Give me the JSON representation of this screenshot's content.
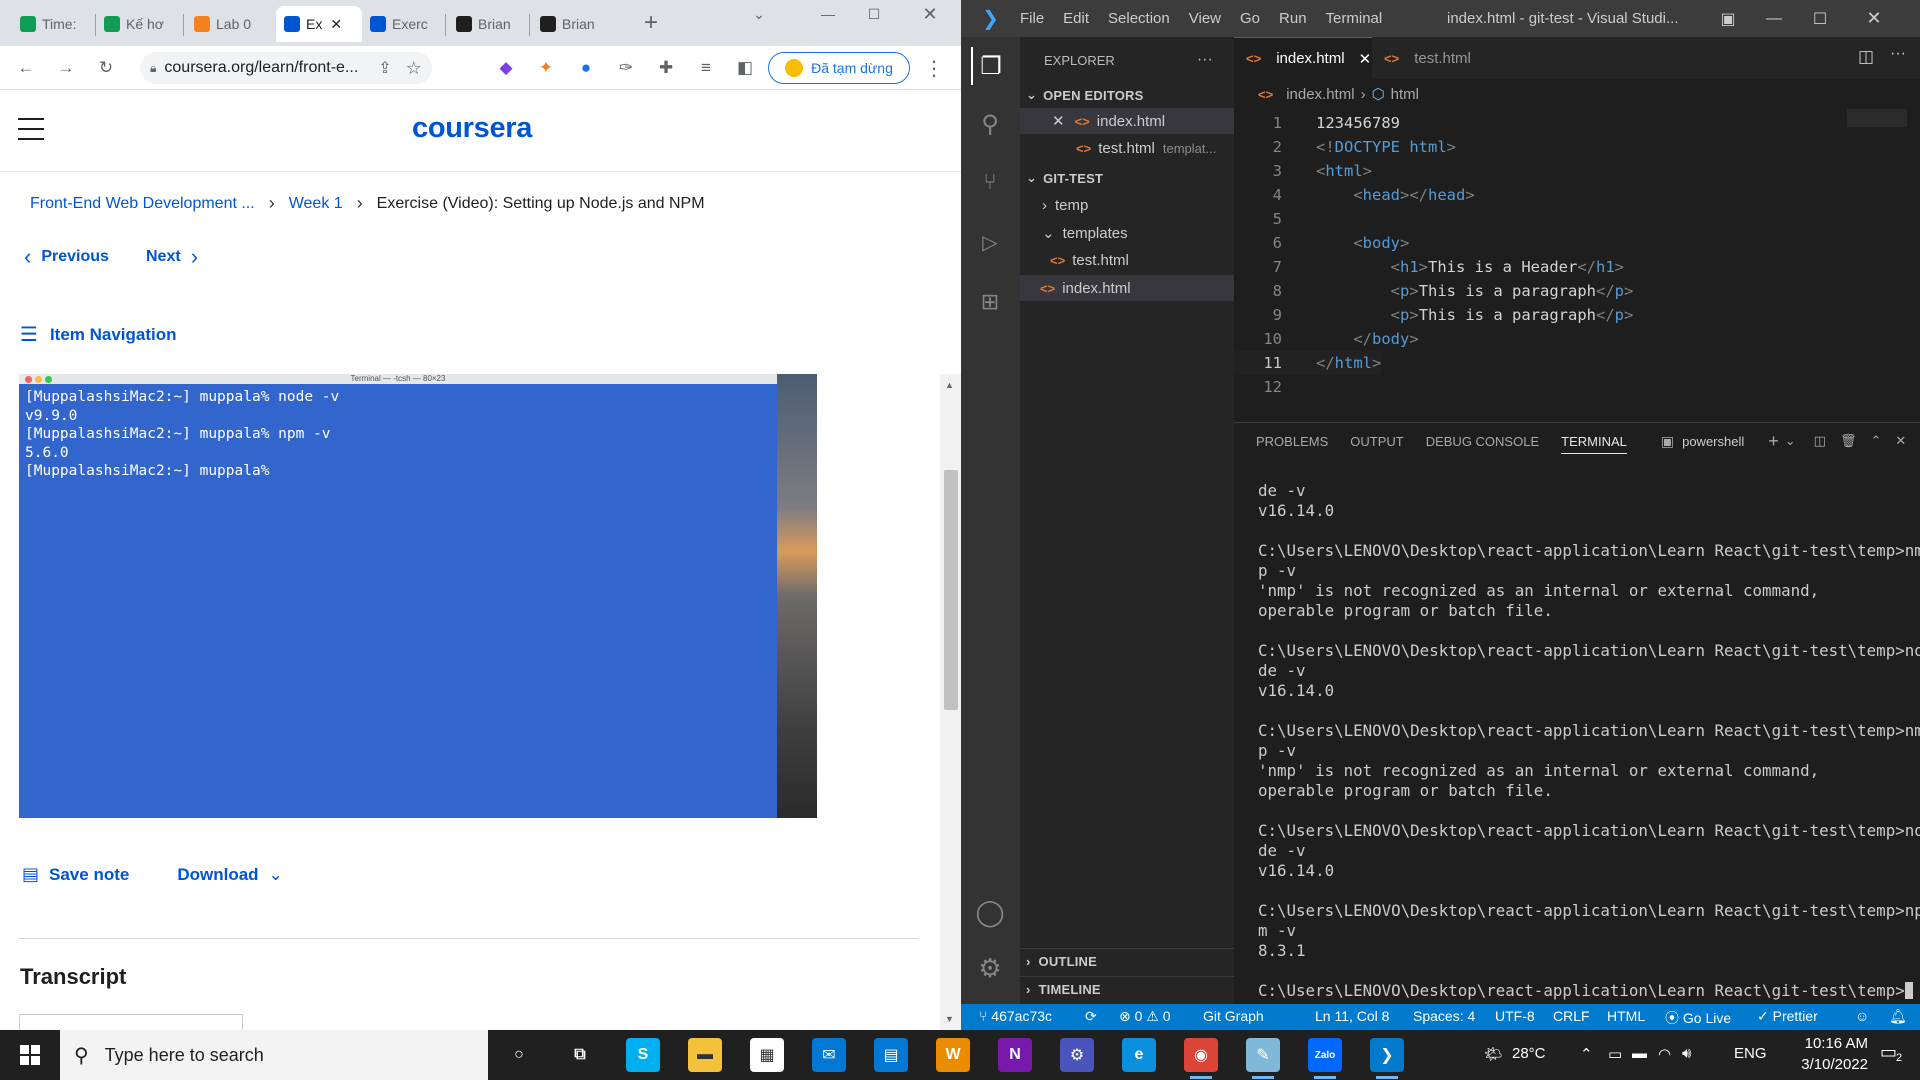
{
  "browser": {
    "tabs": [
      {
        "label": "Time:",
        "icon": "sheets-icon",
        "color": "#0f9d58"
      },
      {
        "label": "Kế hơ",
        "icon": "sheets-icon",
        "color": "#0f9d58"
      },
      {
        "label": "Lab 0",
        "icon": "figure-icon",
        "color": "#f5821f"
      },
      {
        "label": "Ex",
        "icon": "coursera-icon",
        "color": "#0056d2"
      },
      {
        "label": "Exerc",
        "icon": "coursera-icon",
        "color": "#0056d2"
      },
      {
        "label": "Brian",
        "icon": "github-icon",
        "color": "#1f1f1f"
      },
      {
        "label": "Brian",
        "icon": "github-icon",
        "color": "#1f1f1f"
      }
    ],
    "url": "coursera.org/learn/front-e...",
    "paused_label": "Đã tạm dừng"
  },
  "coursera": {
    "logo": "coursera",
    "breadcrumb": {
      "course": "Front-End Web Development ...",
      "week": "Week 1",
      "item": "Exercise (Video): Setting up Node.js and NPM"
    },
    "prev_label": "Previous",
    "next_label": "Next",
    "item_nav_label": "Item Navigation",
    "video": {
      "window_title": "Terminal — -tcsh — 80×23",
      "lines": [
        "[MuppalashsiMac2:~] muppala% node -v",
        "v9.9.0",
        "[MuppalashsiMac2:~] muppala% npm -v",
        "5.6.0",
        "[MuppalashsiMac2:~] muppala% "
      ]
    },
    "save_note_label": "Save note",
    "download_label": "Download",
    "transcript_heading": "Transcript"
  },
  "vscode": {
    "menu": [
      "File",
      "Edit",
      "Selection",
      "View",
      "Go",
      "Run",
      "Terminal"
    ],
    "title": "index.html - git-test - Visual Studi...",
    "explorer_label": "EXPLORER",
    "open_editors_label": "OPEN EDITORS",
    "open_editors": [
      {
        "name": "index.html",
        "detail": ""
      },
      {
        "name": "test.html",
        "detail": "templat..."
      }
    ],
    "workspace_label": "GIT-TEST",
    "tree": [
      {
        "name": "temp",
        "kind": "folder"
      },
      {
        "name": "templates",
        "kind": "folder"
      },
      {
        "name": "test.html",
        "kind": "file"
      },
      {
        "name": "index.html",
        "kind": "file"
      }
    ],
    "outline_label": "OUTLINE",
    "timeline_label": "TIMELINE",
    "editor_tabs": [
      "index.html",
      "test.html"
    ],
    "breadcrumb_file": "index.html",
    "breadcrumb_symbol": "html",
    "code": [
      {
        "n": "1",
        "indent": "",
        "parts": [
          {
            "c": "txt",
            "t": "123456789"
          }
        ]
      },
      {
        "n": "2",
        "indent": "",
        "parts": [
          {
            "c": "punc",
            "t": "<!"
          },
          {
            "c": "tag",
            "t": "DOCTYPE"
          },
          {
            "c": "txt",
            "t": " "
          },
          {
            "c": "tag",
            "t": "html"
          },
          {
            "c": "punc",
            "t": ">"
          }
        ]
      },
      {
        "n": "3",
        "indent": "",
        "parts": [
          {
            "c": "punc",
            "t": "<"
          },
          {
            "c": "tag",
            "t": "html"
          },
          {
            "c": "punc",
            "t": ">"
          }
        ]
      },
      {
        "n": "4",
        "indent": "    ",
        "parts": [
          {
            "c": "punc",
            "t": "<"
          },
          {
            "c": "tag",
            "t": "head"
          },
          {
            "c": "punc",
            "t": "></"
          },
          {
            "c": "tag",
            "t": "head"
          },
          {
            "c": "punc",
            "t": ">"
          }
        ]
      },
      {
        "n": "5",
        "indent": "",
        "parts": []
      },
      {
        "n": "6",
        "indent": "    ",
        "parts": [
          {
            "c": "punc",
            "t": "<"
          },
          {
            "c": "tag",
            "t": "body"
          },
          {
            "c": "punc",
            "t": ">"
          }
        ]
      },
      {
        "n": "7",
        "indent": "        ",
        "parts": [
          {
            "c": "punc",
            "t": "<"
          },
          {
            "c": "tag",
            "t": "h1"
          },
          {
            "c": "punc",
            "t": ">"
          },
          {
            "c": "txt",
            "t": "This is a Header"
          },
          {
            "c": "punc",
            "t": "</"
          },
          {
            "c": "tag",
            "t": "h1"
          },
          {
            "c": "punc",
            "t": ">"
          }
        ]
      },
      {
        "n": "8",
        "indent": "        ",
        "parts": [
          {
            "c": "punc",
            "t": "<"
          },
          {
            "c": "tag",
            "t": "p"
          },
          {
            "c": "punc",
            "t": ">"
          },
          {
            "c": "txt",
            "t": "This is a paragraph"
          },
          {
            "c": "punc",
            "t": "</"
          },
          {
            "c": "tag",
            "t": "p"
          },
          {
            "c": "punc",
            "t": ">"
          }
        ]
      },
      {
        "n": "9",
        "indent": "        ",
        "parts": [
          {
            "c": "punc",
            "t": "<"
          },
          {
            "c": "tag",
            "t": "p"
          },
          {
            "c": "punc",
            "t": ">"
          },
          {
            "c": "txt",
            "t": "This is a paragraph"
          },
          {
            "c": "punc",
            "t": "</"
          },
          {
            "c": "tag",
            "t": "p"
          },
          {
            "c": "punc",
            "t": ">"
          }
        ]
      },
      {
        "n": "10",
        "indent": "    ",
        "parts": [
          {
            "c": "punc",
            "t": "</"
          },
          {
            "c": "tag",
            "t": "body"
          },
          {
            "c": "punc",
            "t": ">"
          }
        ]
      },
      {
        "n": "11",
        "indent": "",
        "parts": [
          {
            "c": "punc",
            "t": "</"
          },
          {
            "c": "tag",
            "t": "html"
          },
          {
            "c": "punc",
            "t": ">"
          }
        ]
      },
      {
        "n": "12",
        "indent": "",
        "parts": []
      }
    ],
    "panel_tabs": [
      "PROBLEMS",
      "OUTPUT",
      "DEBUG CONSOLE",
      "TERMINAL"
    ],
    "terminal_shell": "powershell",
    "terminal_lines": [
      "de -v",
      "v16.14.0",
      "",
      "C:\\Users\\LENOVO\\Desktop\\react-application\\Learn React\\git-test\\temp>nm",
      "p -v",
      "'nmp' is not recognized as an internal or external command,",
      "operable program or batch file.",
      "",
      "C:\\Users\\LENOVO\\Desktop\\react-application\\Learn React\\git-test\\temp>no",
      "de -v",
      "v16.14.0",
      "",
      "C:\\Users\\LENOVO\\Desktop\\react-application\\Learn React\\git-test\\temp>nm",
      "p -v",
      "'nmp' is not recognized as an internal or external command,",
      "operable program or batch file.",
      "",
      "C:\\Users\\LENOVO\\Desktop\\react-application\\Learn React\\git-test\\temp>no",
      "de -v",
      "v16.14.0",
      "",
      "C:\\Users\\LENOVO\\Desktop\\react-application\\Learn React\\git-test\\temp>np",
      "m -v",
      "8.3.1",
      "",
      "C:\\Users\\LENOVO\\Desktop\\react-application\\Learn React\\git-test\\temp>"
    ],
    "status": {
      "branch": "467ac73c",
      "errors": "0",
      "warnings": "0",
      "git_graph": "Git Graph",
      "position": "Ln 11, Col 8",
      "spaces": "Spaces: 4",
      "encoding": "UTF-8",
      "eol": "CRLF",
      "language": "HTML",
      "golive": "Go Live",
      "prettier": "Prettier"
    }
  },
  "taskbar": {
    "search_placeholder": "Type here to search",
    "weather": "28°C",
    "language": "ENG",
    "time": "10:16 AM",
    "date": "3/10/2022",
    "notifications": "2",
    "apps": [
      {
        "name": "cortana-icon",
        "glyph": "○",
        "bg": "transparent"
      },
      {
        "name": "task-view-icon",
        "glyph": "⧉",
        "bg": "transparent"
      },
      {
        "name": "skype-icon",
        "glyph": "S",
        "bg": "#00aff0"
      },
      {
        "name": "file-explorer-icon",
        "glyph": "▬",
        "bg": "#f3c13a"
      },
      {
        "name": "store-icon",
        "glyph": "▦",
        "bg": "#ffffff"
      },
      {
        "name": "mail-icon",
        "glyph": "✉",
        "bg": "#0078d4"
      },
      {
        "name": "calendar-icon",
        "glyph": "▤",
        "bg": "#0078d4"
      },
      {
        "name": "office-icon",
        "glyph": "W",
        "bg": "#eb8c00"
      },
      {
        "name": "onenote-icon",
        "glyph": "N",
        "bg": "#7719aa"
      },
      {
        "name": "teams-icon",
        "glyph": "⚙",
        "bg": "#4b53bc"
      },
      {
        "name": "edge-icon",
        "glyph": "e",
        "bg": "#0c8fdd"
      },
      {
        "name": "chrome-icon",
        "glyph": "◉",
        "bg": "#db4437"
      },
      {
        "name": "notepad-icon",
        "glyph": "✎",
        "bg": "#7fb8d8"
      },
      {
        "name": "zalo-icon",
        "glyph": "Zalo",
        "bg": "#0068ff"
      },
      {
        "name": "vscode-icon",
        "glyph": "❯",
        "bg": "#007acc"
      }
    ]
  }
}
